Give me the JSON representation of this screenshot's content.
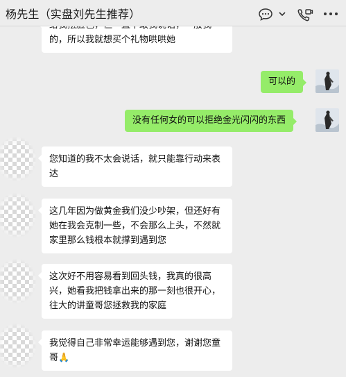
{
  "header": {
    "title": "杨先生（实盘刘先生推荐）",
    "icons": [
      "chat-bubble-icon",
      "chevron-down-icon",
      "video-call-icon",
      "more-icon"
    ]
  },
  "messages": [
    {
      "side": "left",
      "text": "给我摆脸色，但一直不敢我说话，一般我的，所以我就想买个礼物哄哄她"
    },
    {
      "side": "right",
      "text": "可以的"
    },
    {
      "side": "right",
      "text": "没有任何女的可以拒绝金光闪闪的东西"
    },
    {
      "side": "left",
      "text": "您知道的我不太会说话，就只能靠行动来表达"
    },
    {
      "side": "left",
      "text": "这几年因为做黄金我们没少吵架，但还好有她在我会克制一些，不会那么上头，不然就家里那么钱根本就撑到遇到您"
    },
    {
      "side": "left",
      "text": "这次好不用容易看到回头钱，我真的很高兴，她看我把钱拿出来的那一刻也很开心，往大的讲童哥您拯救我的家庭"
    },
    {
      "side": "left",
      "text": "我觉得自己非常幸运能够遇到您，谢谢您童哥",
      "emoji": "🙏"
    }
  ],
  "colors": {
    "background": "#ededed",
    "bubble_left": "#ffffff",
    "bubble_right": "#95ec69"
  }
}
